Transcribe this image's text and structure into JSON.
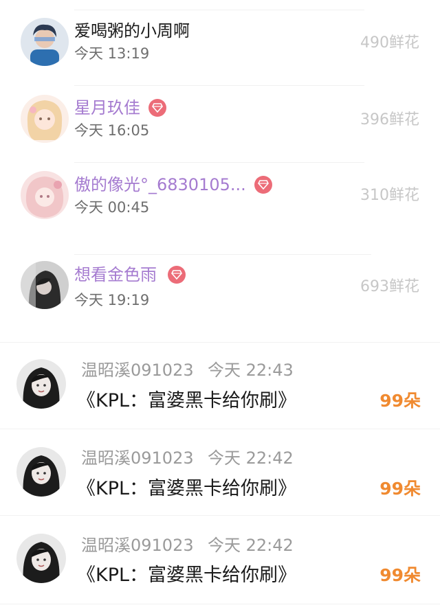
{
  "gifts": [
    {
      "name": "爱喝粥的小周啊",
      "time": "今天 13:19",
      "amount": "490鲜花",
      "vip": false,
      "name_color": "#1a1a1a",
      "avatar_icon": "boy-avatar-icon"
    },
    {
      "name": "星月玖佳",
      "time": "今天 16:05",
      "amount": "396鲜花",
      "vip": true,
      "name_color": "#a57bd0",
      "avatar_icon": "anime-girl-avatar-icon"
    },
    {
      "name": "傲的像光°_6830105...",
      "time": "今天 00:45",
      "amount": "310鲜花",
      "vip": true,
      "name_color": "#a57bd0",
      "avatar_icon": "pink-anime-avatar-icon"
    },
    {
      "name": "想看金色雨",
      "time": "今天 19:19",
      "amount": "693鲜花",
      "vip": true,
      "name_color": "#a57bd0",
      "avatar_icon": "dark-girl-avatar-icon"
    }
  ],
  "tips": [
    {
      "user": "温昭溪091023",
      "time": "今天 22:43",
      "work": "《KPL：富婆黑卡给你刷》",
      "amount": "99朵",
      "avatar_icon": "bw-girl-avatar-icon"
    },
    {
      "user": "温昭溪091023",
      "time": "今天 22:42",
      "work": "《KPL：富婆黑卡给你刷》",
      "amount": "99朵",
      "avatar_icon": "bw-girl-avatar-icon"
    },
    {
      "user": "温昭溪091023",
      "time": "今天 22:42",
      "work": "《KPL：富婆黑卡给你刷》",
      "amount": "99朵",
      "avatar_icon": "bw-girl-avatar-icon"
    }
  ],
  "colors": {
    "vip_gem": "#ec6c78",
    "flower_orange": "#f08a30",
    "vip_name": "#a57bd0"
  }
}
